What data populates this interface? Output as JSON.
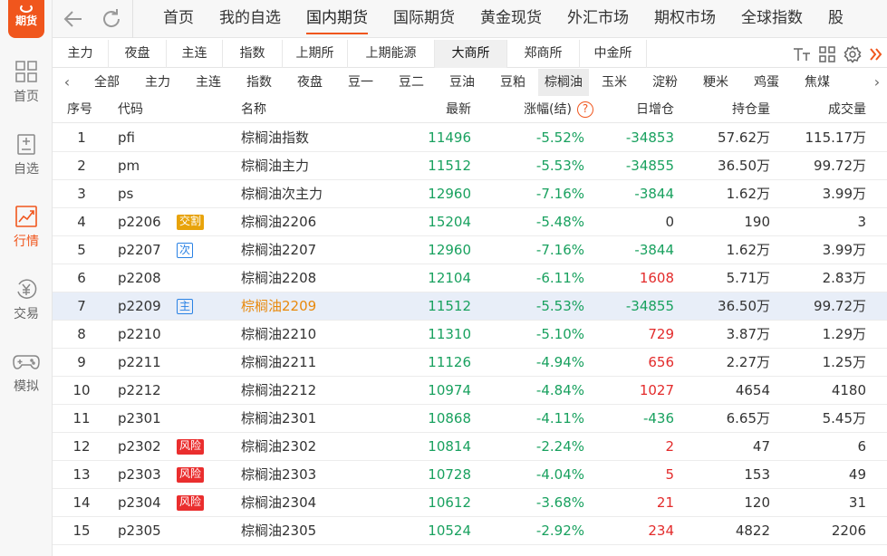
{
  "app": {
    "logo_text": "期货"
  },
  "sidebar": {
    "items": [
      {
        "label": "首页",
        "icon": "grid-icon"
      },
      {
        "label": "自选",
        "icon": "watchlist-icon"
      },
      {
        "label": "行情",
        "icon": "chart-icon",
        "active": true
      },
      {
        "label": "交易",
        "icon": "yen-icon"
      },
      {
        "label": "模拟",
        "icon": "gamepad-icon"
      }
    ]
  },
  "top_tabs": [
    {
      "label": "首页"
    },
    {
      "label": "我的自选"
    },
    {
      "label": "国内期货",
      "active": true
    },
    {
      "label": "国际期货"
    },
    {
      "label": "黄金现货"
    },
    {
      "label": "外汇市场"
    },
    {
      "label": "期权市场"
    },
    {
      "label": "全球指数"
    },
    {
      "label": "股"
    }
  ],
  "exchange_tabs": [
    {
      "label": "主力"
    },
    {
      "label": "夜盘"
    },
    {
      "label": "主连"
    },
    {
      "label": "指数"
    },
    {
      "label": "上期所"
    },
    {
      "label": "上期能源"
    },
    {
      "label": "大商所",
      "active": true
    },
    {
      "label": "郑商所"
    },
    {
      "label": "中金所"
    }
  ],
  "categories": [
    {
      "label": "全部"
    },
    {
      "label": "主力"
    },
    {
      "label": "主连"
    },
    {
      "label": "指数"
    },
    {
      "label": "夜盘"
    },
    {
      "label": "豆一"
    },
    {
      "label": "豆二"
    },
    {
      "label": "豆油"
    },
    {
      "label": "豆粕"
    },
    {
      "label": "棕榈油",
      "active": true
    },
    {
      "label": "玉米"
    },
    {
      "label": "淀粉"
    },
    {
      "label": "粳米"
    },
    {
      "label": "鸡蛋"
    },
    {
      "label": "焦煤"
    }
  ],
  "table": {
    "headers": {
      "idx": "序号",
      "code": "代码",
      "name": "名称",
      "last": "最新",
      "chg": "涨幅(结)",
      "dz": "日增仓",
      "oi": "持仓量",
      "vol": "成交量"
    },
    "rows": [
      {
        "idx": "1",
        "code": "pfi",
        "tag": "",
        "name": "棕榈油指数",
        "last": "11496",
        "chg": "-5.52%",
        "dz": "-34853",
        "oi": "57.62万",
        "vol": "115.17万"
      },
      {
        "idx": "2",
        "code": "pm",
        "tag": "",
        "name": "棕榈油主力",
        "last": "11512",
        "chg": "-5.53%",
        "dz": "-34855",
        "oi": "36.50万",
        "vol": "99.72万"
      },
      {
        "idx": "3",
        "code": "ps",
        "tag": "",
        "name": "棕榈油次主力",
        "last": "12960",
        "chg": "-7.16%",
        "dz": "-3844",
        "oi": "1.62万",
        "vol": "3.99万"
      },
      {
        "idx": "4",
        "code": "p2206",
        "tag": "交割",
        "tag_type": "jg",
        "name": "棕榈油2206",
        "last": "15204",
        "chg": "-5.48%",
        "dz": "0",
        "oi": "190",
        "vol": "3"
      },
      {
        "idx": "5",
        "code": "p2207",
        "tag": "次",
        "tag_type": "ci",
        "name": "棕榈油2207",
        "last": "12960",
        "chg": "-7.16%",
        "dz": "-3844",
        "oi": "1.62万",
        "vol": "3.99万"
      },
      {
        "idx": "6",
        "code": "p2208",
        "tag": "",
        "name": "棕榈油2208",
        "last": "12104",
        "chg": "-6.11%",
        "dz": "1608",
        "oi": "5.71万",
        "vol": "2.83万"
      },
      {
        "idx": "7",
        "code": "p2209",
        "tag": "主",
        "tag_type": "zhu",
        "name": "棕榈油2209",
        "last": "11512",
        "chg": "-5.53%",
        "dz": "-34855",
        "oi": "36.50万",
        "vol": "99.72万",
        "selected": true
      },
      {
        "idx": "8",
        "code": "p2210",
        "tag": "",
        "name": "棕榈油2210",
        "last": "11310",
        "chg": "-5.10%",
        "dz": "729",
        "oi": "3.87万",
        "vol": "1.29万"
      },
      {
        "idx": "9",
        "code": "p2211",
        "tag": "",
        "name": "棕榈油2211",
        "last": "11126",
        "chg": "-4.94%",
        "dz": "656",
        "oi": "2.27万",
        "vol": "1.25万"
      },
      {
        "idx": "10",
        "code": "p2212",
        "tag": "",
        "name": "棕榈油2212",
        "last": "10974",
        "chg": "-4.84%",
        "dz": "1027",
        "oi": "4654",
        "vol": "4180"
      },
      {
        "idx": "11",
        "code": "p2301",
        "tag": "",
        "name": "棕榈油2301",
        "last": "10868",
        "chg": "-4.11%",
        "dz": "-436",
        "oi": "6.65万",
        "vol": "5.45万"
      },
      {
        "idx": "12",
        "code": "p2302",
        "tag": "风险",
        "tag_type": "fx",
        "name": "棕榈油2302",
        "last": "10814",
        "chg": "-2.24%",
        "dz": "2",
        "oi": "47",
        "vol": "6"
      },
      {
        "idx": "13",
        "code": "p2303",
        "tag": "风险",
        "tag_type": "fx",
        "name": "棕榈油2303",
        "last": "10728",
        "chg": "-4.04%",
        "dz": "5",
        "oi": "153",
        "vol": "49"
      },
      {
        "idx": "14",
        "code": "p2304",
        "tag": "风险",
        "tag_type": "fx",
        "name": "棕榈油2304",
        "last": "10612",
        "chg": "-3.68%",
        "dz": "21",
        "oi": "120",
        "vol": "31"
      },
      {
        "idx": "15",
        "code": "p2305",
        "tag": "",
        "name": "棕榈油2305",
        "last": "10524",
        "chg": "-2.92%",
        "dz": "234",
        "oi": "4822",
        "vol": "2206"
      }
    ]
  },
  "colors": {
    "accent": "#f0561d",
    "down": "#19a15f",
    "up": "#e32b2b",
    "selected_row": "#e8eef8",
    "tag_delivery": "#e8a30a",
    "tag_risk": "#ea2e2e",
    "tag_outline": "#2a82e4"
  }
}
